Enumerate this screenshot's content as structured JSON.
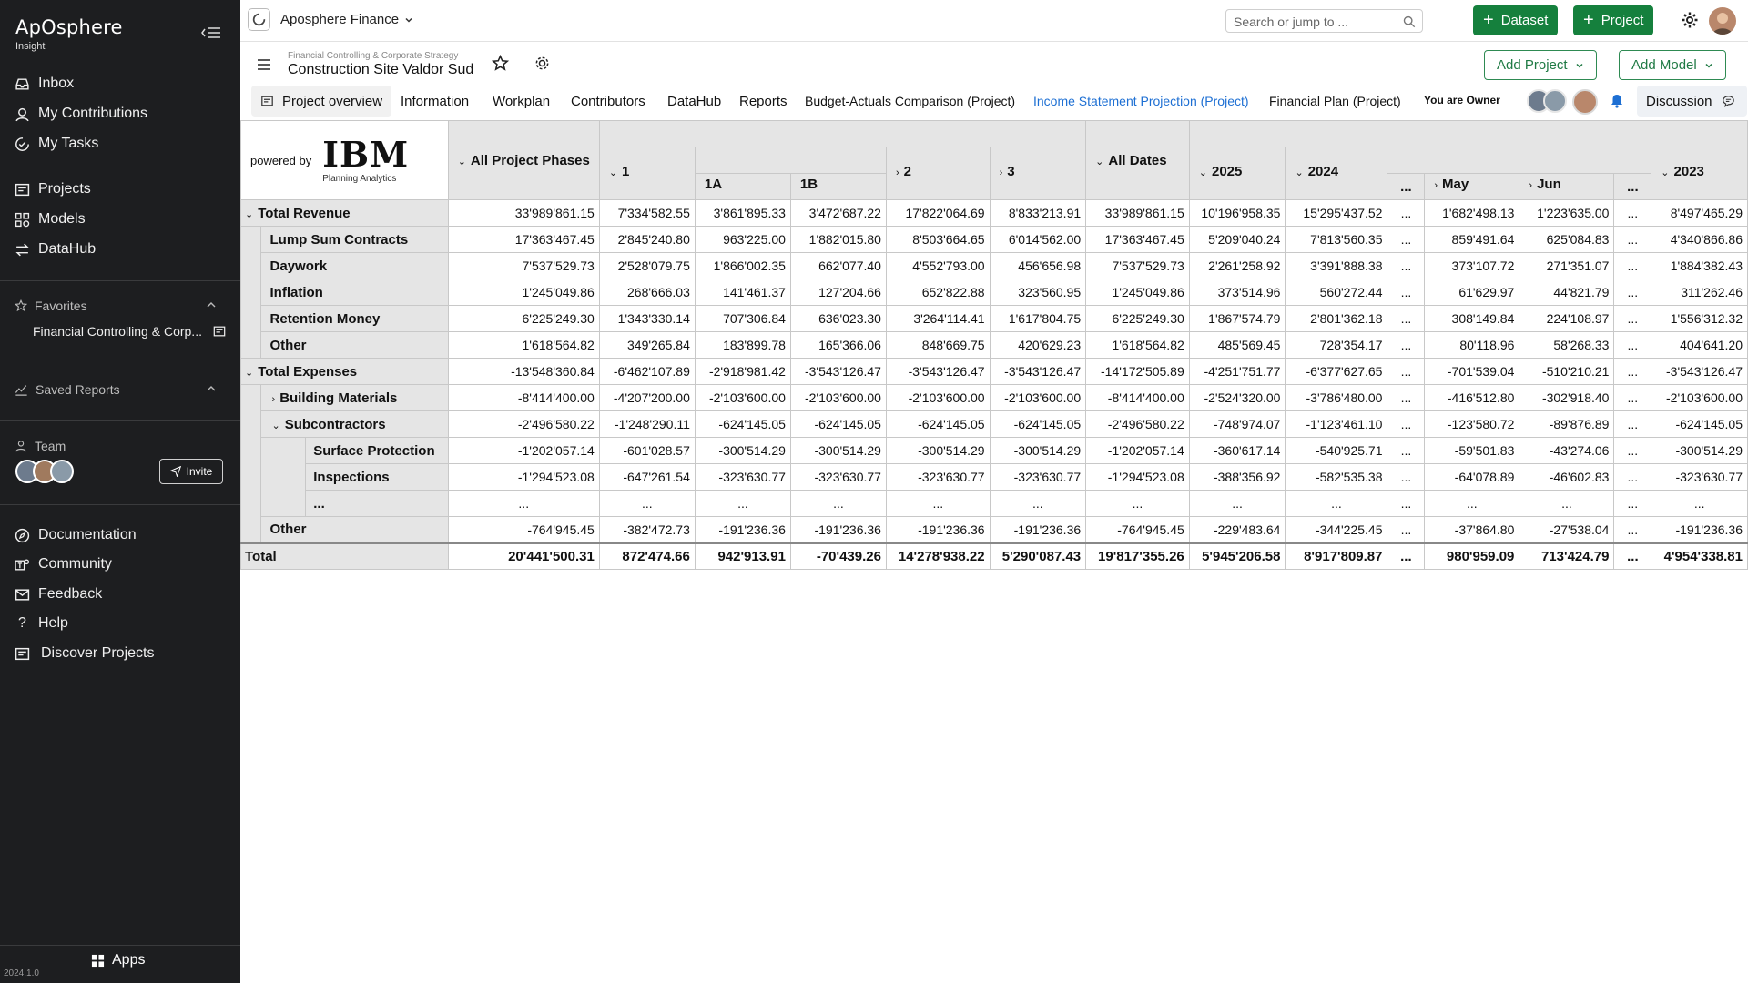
{
  "sidebar": {
    "brand": "ApOsphere",
    "subtitle": "Insight",
    "nav": [
      "Inbox",
      "My Contributions",
      "My Tasks",
      "Projects",
      "Models",
      "DataHub"
    ],
    "favorites_label": "Favorites",
    "favorite_item": "Financial Controlling & Corp...",
    "saved_reports_label": "Saved Reports",
    "team_label": "Team",
    "invite_label": "Invite",
    "links": [
      "Documentation",
      "Community",
      "Feedback",
      "Help",
      "Discover Projects"
    ],
    "apps_label": "Apps",
    "version": "2024.1.0"
  },
  "topbar": {
    "workspace": "Aposphere Finance",
    "search_placeholder": "Search or jump to ...",
    "dataset_button": "Dataset",
    "project_button": "Project"
  },
  "project": {
    "breadcrumb": "Financial Controlling & Corporate Strategy",
    "title": "Construction Site Valdor Sud",
    "add_project": "Add Project",
    "add_model": "Add Model",
    "tabs": [
      "Project overview",
      "Information",
      "Workplan",
      "Contributors",
      "DataHub",
      "Reports",
      "Budget-Actuals Comparison (Project)",
      "Income Statement Projection (Project)",
      "Financial Plan (Project)"
    ],
    "active_tab": "Income Statement Projection (Project)",
    "owner_text": "You are Owner",
    "discussion": "Discussion"
  },
  "grid": {
    "powered_by": "powered by",
    "ibm_logo": "IBM",
    "ibm_subtitle": "Planning Analytics",
    "headers": {
      "all_phases": "All Project Phases",
      "p1": "1",
      "p1a": "1A",
      "p1b": "1B",
      "p2": "2",
      "p3": "3",
      "all_dates": "All Dates",
      "y2025": "2025",
      "y2024": "2024",
      "ell": "...",
      "may": "May",
      "jun": "Jun",
      "y2023": "2023"
    },
    "rows": [
      {
        "label": "Total Revenue",
        "values": [
          "33'989'861.15",
          "7'334'582.55",
          "3'861'895.33",
          "3'472'687.22",
          "17'822'064.69",
          "8'833'213.91",
          "33'989'861.15",
          "10'196'958.35",
          "15'295'437.52",
          "...",
          "1'682'498.13",
          "1'223'635.00",
          "...",
          "8'497'465.29"
        ]
      },
      {
        "label": "Lump Sum Contracts",
        "values": [
          "17'363'467.45",
          "2'845'240.80",
          "963'225.00",
          "1'882'015.80",
          "8'503'664.65",
          "6'014'562.00",
          "17'363'467.45",
          "5'209'040.24",
          "7'813'560.35",
          "...",
          "859'491.64",
          "625'084.83",
          "...",
          "4'340'866.86"
        ]
      },
      {
        "label": "Daywork",
        "values": [
          "7'537'529.73",
          "2'528'079.75",
          "1'866'002.35",
          "662'077.40",
          "4'552'793.00",
          "456'656.98",
          "7'537'529.73",
          "2'261'258.92",
          "3'391'888.38",
          "...",
          "373'107.72",
          "271'351.07",
          "...",
          "1'884'382.43"
        ]
      },
      {
        "label": "Inflation",
        "values": [
          "1'245'049.86",
          "268'666.03",
          "141'461.37",
          "127'204.66",
          "652'822.88",
          "323'560.95",
          "1'245'049.86",
          "373'514.96",
          "560'272.44",
          "...",
          "61'629.97",
          "44'821.79",
          "...",
          "311'262.46"
        ]
      },
      {
        "label": "Retention Money",
        "values": [
          "6'225'249.30",
          "1'343'330.14",
          "707'306.84",
          "636'023.30",
          "3'264'114.41",
          "1'617'804.75",
          "6'225'249.30",
          "1'867'574.79",
          "2'801'362.18",
          "...",
          "308'149.84",
          "224'108.97",
          "...",
          "1'556'312.32"
        ]
      },
      {
        "label": "Other",
        "values": [
          "1'618'564.82",
          "349'265.84",
          "183'899.78",
          "165'366.06",
          "848'669.75",
          "420'629.23",
          "1'618'564.82",
          "485'569.45",
          "728'354.17",
          "...",
          "80'118.96",
          "58'268.33",
          "...",
          "404'641.20"
        ]
      },
      {
        "label": "Total Expenses",
        "values": [
          "-13'548'360.84",
          "-6'462'107.89",
          "-2'918'981.42",
          "-3'543'126.47",
          "-3'543'126.47",
          "-3'543'126.47",
          "-14'172'505.89",
          "-4'251'751.77",
          "-6'377'627.65",
          "...",
          "-701'539.04",
          "-510'210.21",
          "...",
          "-3'543'126.47"
        ]
      },
      {
        "label": "Building Materials",
        "values": [
          "-8'414'400.00",
          "-4'207'200.00",
          "-2'103'600.00",
          "-2'103'600.00",
          "-2'103'600.00",
          "-2'103'600.00",
          "-8'414'400.00",
          "-2'524'320.00",
          "-3'786'480.00",
          "...",
          "-416'512.80",
          "-302'918.40",
          "...",
          "-2'103'600.00"
        ]
      },
      {
        "label": "Subcontractors",
        "values": [
          "-2'496'580.22",
          "-1'248'290.11",
          "-624'145.05",
          "-624'145.05",
          "-624'145.05",
          "-624'145.05",
          "-2'496'580.22",
          "-748'974.07",
          "-1'123'461.10",
          "...",
          "-123'580.72",
          "-89'876.89",
          "...",
          "-624'145.05"
        ]
      },
      {
        "label": "Surface Protection",
        "values": [
          "-1'202'057.14",
          "-601'028.57",
          "-300'514.29",
          "-300'514.29",
          "-300'514.29",
          "-300'514.29",
          "-1'202'057.14",
          "-360'617.14",
          "-540'925.71",
          "...",
          "-59'501.83",
          "-43'274.06",
          "...",
          "-300'514.29"
        ]
      },
      {
        "label": "Inspections",
        "values": [
          "-1'294'523.08",
          "-647'261.54",
          "-323'630.77",
          "-323'630.77",
          "-323'630.77",
          "-323'630.77",
          "-1'294'523.08",
          "-388'356.92",
          "-582'535.38",
          "...",
          "-64'078.89",
          "-46'602.83",
          "...",
          "-323'630.77"
        ]
      },
      {
        "label": "...",
        "values": [
          "...",
          "...",
          "...",
          "...",
          "...",
          "...",
          "...",
          "...",
          "...",
          "...",
          "...",
          "...",
          "...",
          "..."
        ]
      },
      {
        "label": "Other",
        "values": [
          "-764'945.45",
          "-382'472.73",
          "-191'236.36",
          "-191'236.36",
          "-191'236.36",
          "-191'236.36",
          "-764'945.45",
          "-229'483.64",
          "-344'225.45",
          "...",
          "-37'864.80",
          "-27'538.04",
          "...",
          "-191'236.36"
        ]
      },
      {
        "label": "Total",
        "values": [
          "20'441'500.31",
          "872'474.66",
          "942'913.91",
          "-70'439.26",
          "14'278'938.22",
          "5'290'087.43",
          "19'817'355.26",
          "5'945'206.58",
          "8'917'809.87",
          "...",
          "980'959.09",
          "713'424.79",
          "...",
          "4'954'338.81"
        ]
      }
    ]
  }
}
